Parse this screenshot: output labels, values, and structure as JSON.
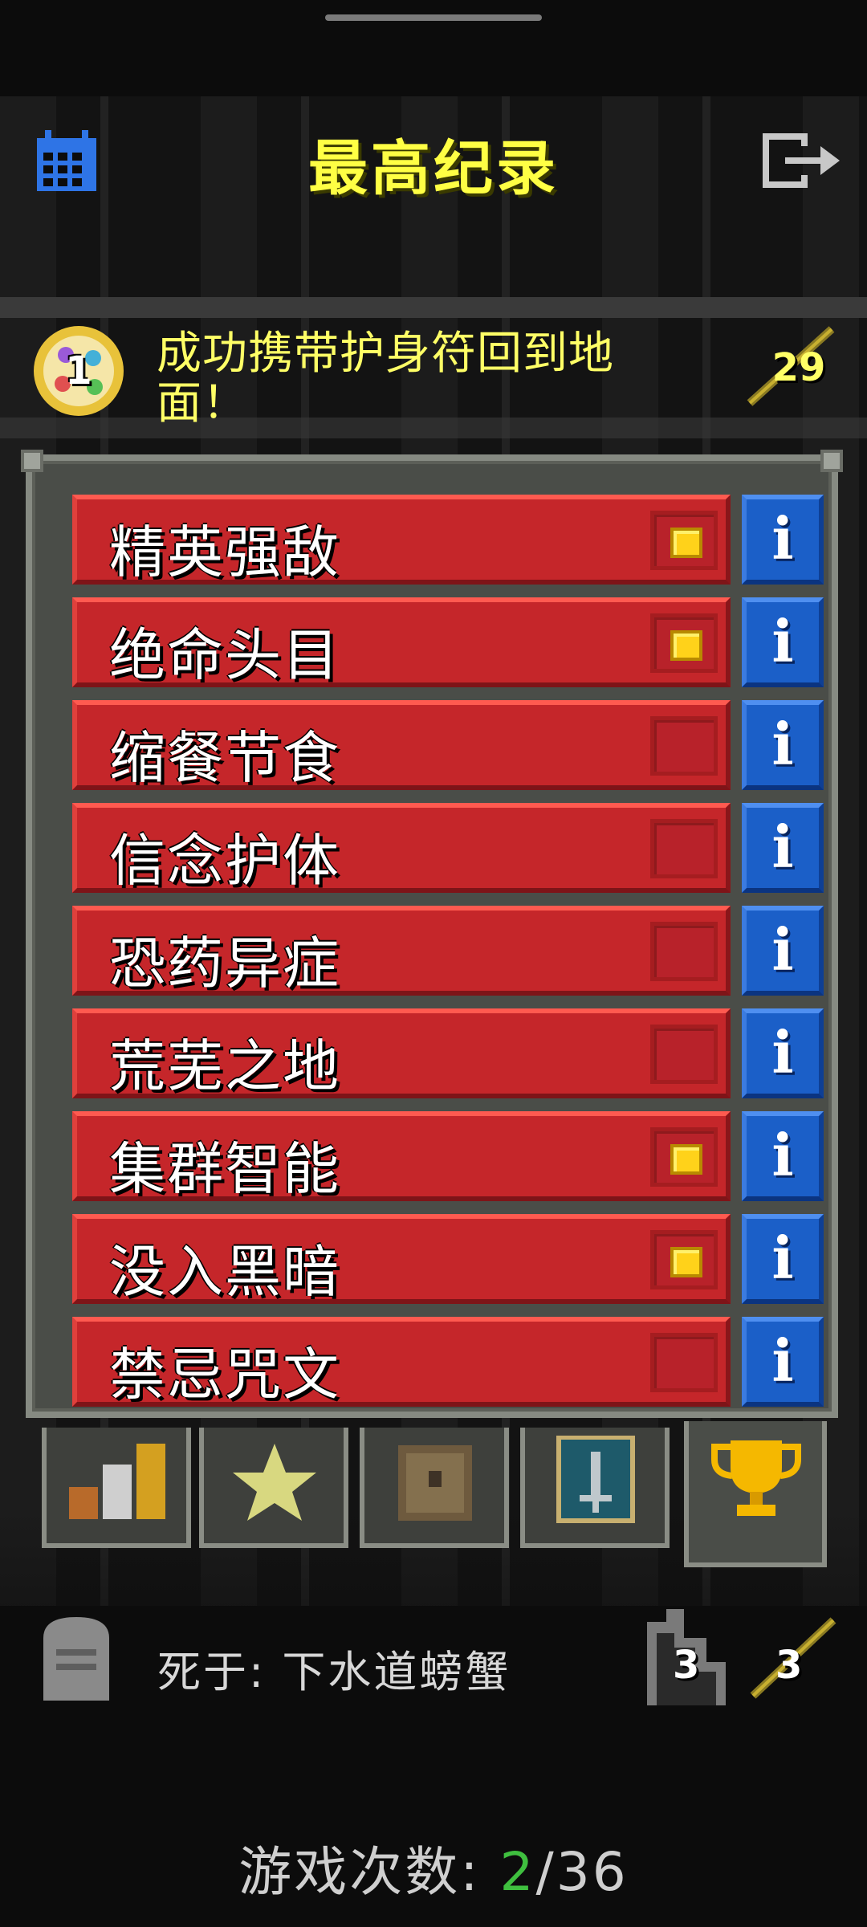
{
  "header": {
    "title": "最高纪录",
    "calendar_icon": "calendar-icon",
    "exit_icon": "exit-icon"
  },
  "record": {
    "badge_number": "1",
    "text": "成功携带护身符回到地面！",
    "depth": "29"
  },
  "challenges": [
    {
      "label": "精英强敌",
      "checked": true
    },
    {
      "label": "绝命头目",
      "checked": true
    },
    {
      "label": "缩餐节食",
      "checked": false
    },
    {
      "label": "信念护体",
      "checked": false
    },
    {
      "label": "恐药异症",
      "checked": false
    },
    {
      "label": "荒芜之地",
      "checked": false
    },
    {
      "label": "集群智能",
      "checked": true
    },
    {
      "label": "没入黑暗",
      "checked": true
    },
    {
      "label": "禁忌咒文",
      "checked": false
    }
  ],
  "tabs": [
    {
      "icon": "stats-bars-icon"
    },
    {
      "icon": "star-icon"
    },
    {
      "icon": "chest-icon"
    },
    {
      "icon": "sword-card-icon"
    },
    {
      "icon": "trophy-icon",
      "active": true
    }
  ],
  "death": {
    "text": "死于: 下水道螃蟹",
    "depth": "3",
    "weapon_level": "3"
  },
  "footer": {
    "label": "游戏次数: ",
    "current": "2",
    "total": "/36"
  },
  "colors": {
    "title": "#ffff44",
    "row_red": "#c5262a",
    "info_blue": "#1b5fc8",
    "check_yellow": "#ffd21a",
    "games_current": "#3fbf3f"
  }
}
